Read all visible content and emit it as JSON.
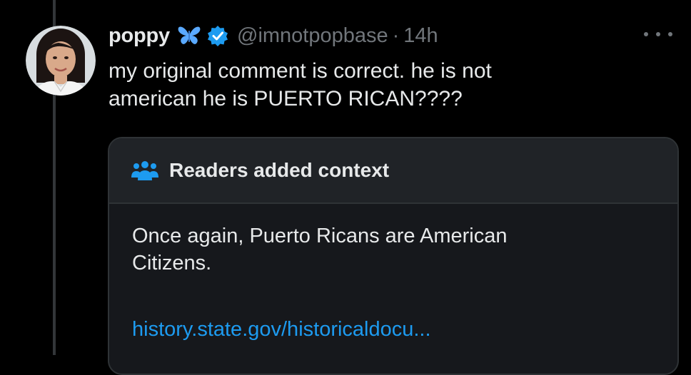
{
  "tweet": {
    "display_name": "poppy",
    "handle": "@imnotpopbase",
    "separator": "·",
    "time": "14h",
    "text_line1": "my original comment is correct. he is not",
    "text_line2": "american he is PUERTO RICAN????",
    "icons": {
      "butterfly": "butterfly-emoji",
      "verified": "verified-badge-icon",
      "more": "more-options-icon"
    }
  },
  "community_note": {
    "title": "Readers added context",
    "icon": "readers-group-icon",
    "body_line1": "Once again, Puerto Ricans are American",
    "body_line2": "Citizens.",
    "link_text": "history.state.gov/historicaldocu..."
  },
  "colors": {
    "background": "#000000",
    "text_primary": "#e7e9ea",
    "text_secondary": "#71767b",
    "link": "#1d9bf0",
    "verified": "#1d9bf0",
    "note_header_bg": "#202327",
    "note_body_bg": "#16181c"
  }
}
